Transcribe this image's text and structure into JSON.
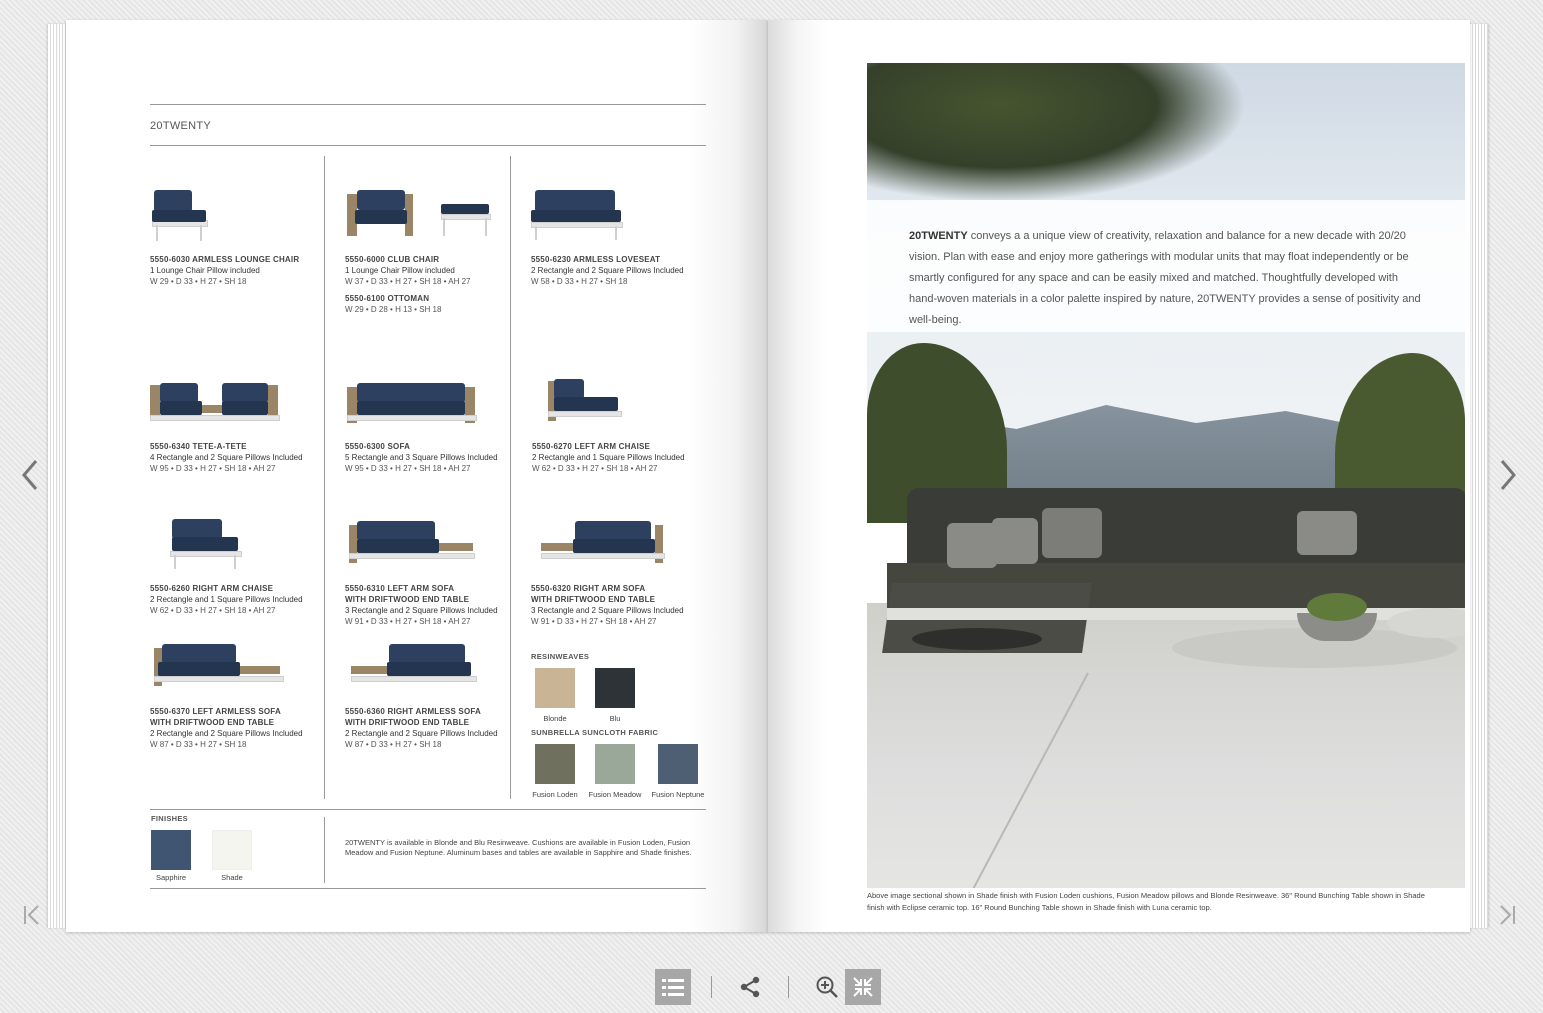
{
  "brand": "20TWENTY",
  "products": [
    {
      "title": "5550-6030 ARMLESS LOUNGE CHAIR",
      "desc": "1 Lounge Chair Pillow included",
      "dims": "W 29 • D 33 • H 27 • SH 18"
    },
    {
      "title": "5550-6000 CLUB CHAIR",
      "desc": "1 Lounge Chair Pillow included",
      "dims": "W 37 • D 33 • H 27 • SH 18 • AH 27",
      "title2": "5550-6100 OTTOMAN",
      "dims2": "W 29 • D 28 • H 13 • SH 18"
    },
    {
      "title": "5550-6230 ARMLESS LOVESEAT",
      "desc": "2 Rectangle and 2 Square Pillows Included",
      "dims": "W 58 • D 33 • H 27 • SH 18"
    },
    {
      "title": "5550-6340 TETE-A-TETE",
      "desc": "4 Rectangle and 2 Square Pillows Included",
      "dims": "W 95 • D 33 • H 27 • SH 18 • AH 27"
    },
    {
      "title": "5550-6300 SOFA",
      "desc": "5 Rectangle and 3 Square Pillows Included",
      "dims": "W 95 • D 33 • H 27 • SH 18 • AH 27"
    },
    {
      "title": "5550-6270 LEFT ARM CHAISE",
      "desc": "2 Rectangle and 1 Square Pillows Included",
      "dims": "W 62 • D 33 • H 27 • SH 18 • AH 27"
    },
    {
      "title": "5550-6260 RIGHT ARM CHAISE",
      "desc": "2 Rectangle and 1 Square Pillows Included",
      "dims": "W 62 • D 33 • H 27 • SH 18 • AH 27"
    },
    {
      "title": "5550-6310 LEFT ARM SOFA",
      "title_b": "WITH DRIFTWOOD END TABLE",
      "desc": "3 Rectangle and 2 Square Pillows Included",
      "dims": "W 91 • D 33 • H 27 • SH 18 • AH 27"
    },
    {
      "title": "5550-6320 RIGHT ARM SOFA",
      "title_b": "WITH DRIFTWOOD END TABLE",
      "desc": "3 Rectangle and 2 Square Pillows Included",
      "dims": "W 91 • D 33 • H 27 • SH 18 • AH 27"
    },
    {
      "title": "5550-6370 LEFT ARMLESS SOFA",
      "title_b": "WITH DRIFTWOOD END TABLE",
      "desc": "2 Rectangle and 2 Square Pillows Included",
      "dims": "W 87 • D 33 • H 27 • SH 18"
    },
    {
      "title": "5550-6360 RIGHT ARMLESS SOFA",
      "title_b": "WITH DRIFTWOOD END TABLE",
      "desc": "2 Rectangle and 2 Square Pillows Included",
      "dims": "W 87 • D 33 • H 27 • SH 18"
    }
  ],
  "resinweaves": {
    "label": "RESINWEAVES",
    "items": [
      {
        "name": "Blonde",
        "color": "#c9b496"
      },
      {
        "name": "Blu",
        "color": "#2e3338"
      }
    ]
  },
  "fabric": {
    "label": "SUNBRELLA SUNCLOTH FABRIC",
    "items": [
      {
        "name": "Fusion Loden",
        "color": "#6f705e"
      },
      {
        "name": "Fusion Meadow",
        "color": "#9aa89a"
      },
      {
        "name": "Fusion Neptune",
        "color": "#4f5f73"
      }
    ]
  },
  "finishes": {
    "label": "FINISHES",
    "items": [
      {
        "name": "Sapphire",
        "color": "#3f5572"
      },
      {
        "name": "Shade",
        "color": "#f5f5f0"
      }
    ],
    "note": "20TWENTY is available in Blonde and Blu Resinweave. Cushions are available in Fusion Loden, Fusion Meadow and Fusion Neptune. Aluminum bases and tables are available in Sapphire and Shade finishes."
  },
  "intro": {
    "brand": "20TWENTY",
    "text": " conveys a a unique view of creativity, relaxation and balance for a new decade with 20/20 vision. Plan with ease and enjoy more gatherings with modular units that may float independently or be smartly configured for any space and can be easily mixed and matched. Thoughtfully developed with hand-woven materials in a color palette inspired by nature, 20TWENTY provides a sense of positivity and well-being."
  },
  "caption": "Above image sectional shown in Shade finish with Fusion Loden cushions, Fusion Meadow pillows and Blonde Resinweave. 36\" Round Bunching Table shown in Shade finish with Eclipse ceramic top. 16\" Round Bunching Table shown in Shade finish with Luna ceramic top."
}
